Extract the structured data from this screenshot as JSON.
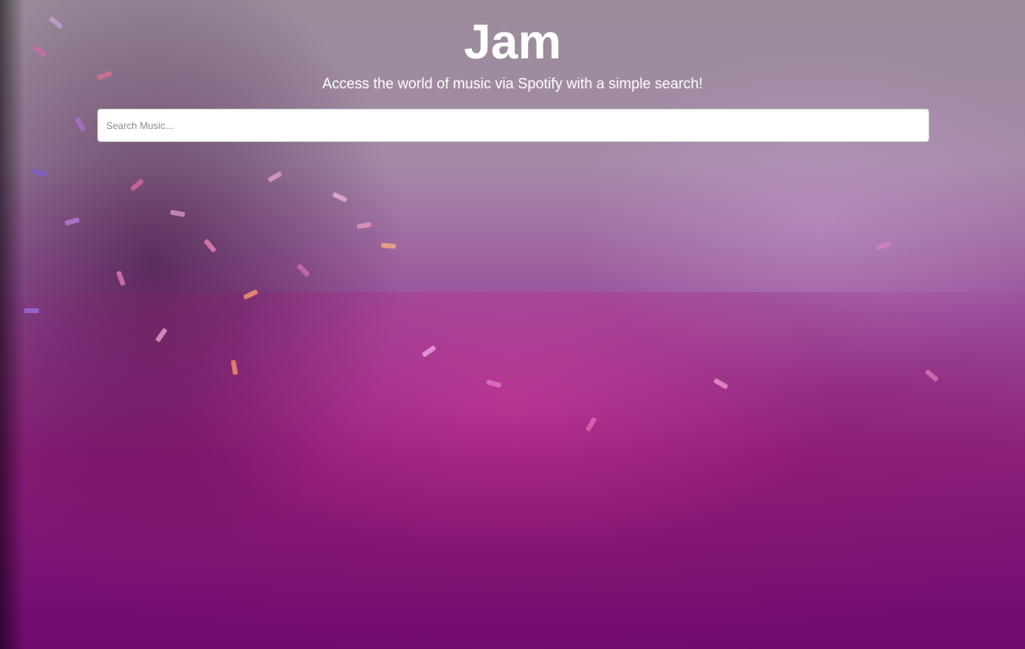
{
  "header": {
    "title": "Jam",
    "subtitle": "Access the world of music via Spotify with a simple search!"
  },
  "search": {
    "placeholder": "Search Music...",
    "value": ""
  },
  "theme": {
    "accent": "#7a0a78",
    "text": "#ffffff"
  }
}
